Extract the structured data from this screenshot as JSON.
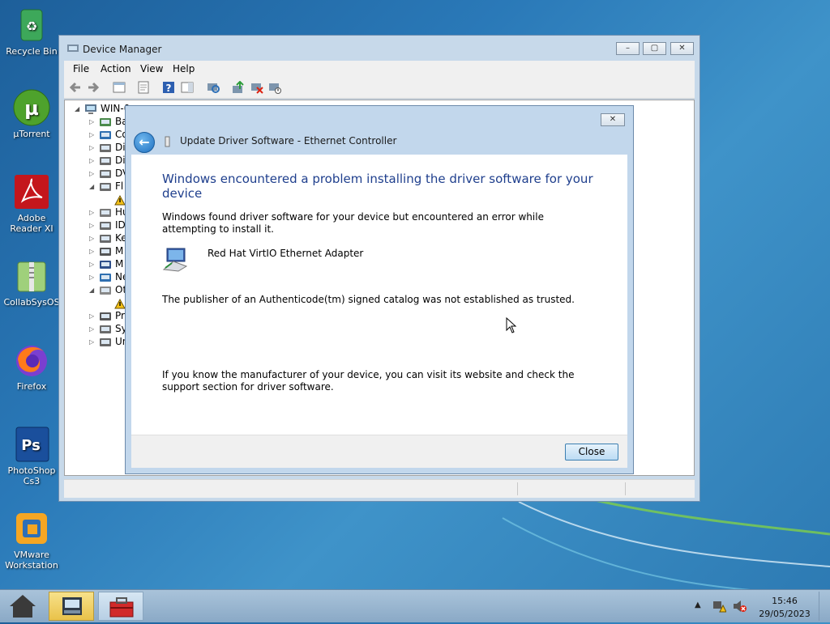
{
  "desktop": {
    "icons": [
      {
        "label": "Recycle Bin",
        "icon": "recycle-bin-icon"
      },
      {
        "label": "µTorrent",
        "icon": "utorrent-icon"
      },
      {
        "label": "Adobe Reader XI",
        "icon": "adobe-reader-icon"
      },
      {
        "label": "CollabSysOS",
        "icon": "folder-zip-icon"
      },
      {
        "label": "Firefox",
        "icon": "firefox-icon"
      },
      {
        "label": "PhotoShop Cs3",
        "icon": "photoshop-icon"
      },
      {
        "label": "VMware Workstation",
        "icon": "vmware-icon"
      }
    ]
  },
  "device_manager": {
    "title": "Device Manager",
    "menu": [
      "File",
      "Action",
      "View",
      "Help"
    ],
    "tree_root": "WIN-0",
    "tree_items": [
      "Ba",
      "Co",
      "Di",
      "Di",
      "DV",
      "Fl",
      "",
      "Hu",
      "ID",
      "Ke",
      "M",
      "M",
      "Ne",
      "Ot",
      "",
      "Pr",
      "Sy",
      "Un"
    ]
  },
  "dialog": {
    "header_title": "Update Driver Software - Ethernet Controller",
    "heading": "Windows encountered a problem installing the driver software for your device",
    "paragraph1": "Windows found driver software for your device but encountered an error while attempting to install it.",
    "device_name": "Red Hat VirtIO Ethernet Adapter",
    "paragraph2": "The publisher of an Authenticode(tm) signed catalog was not established as trusted.",
    "paragraph3": "If you know the manufacturer of your device, you can visit its website and check the support section for driver software.",
    "close_label": "Close",
    "close_glyph": "✕"
  },
  "taskbar": {
    "time": "15:46",
    "date": "29/05/2023"
  }
}
